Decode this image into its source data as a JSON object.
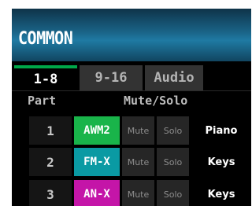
{
  "header": {
    "title": "COMMON"
  },
  "tabs": [
    {
      "label": "1-8",
      "active": true
    },
    {
      "label": "9-16",
      "active": false
    },
    {
      "label": "Audio",
      "active": false
    }
  ],
  "columns": {
    "part": "Part",
    "mute_solo": "Mute/Solo"
  },
  "rows": [
    {
      "part": "1",
      "engine": "AWM2",
      "engine_color": "#19b44a",
      "mute": "Mute",
      "solo": "Solo",
      "type": "Piano"
    },
    {
      "part": "2",
      "engine": "FM-X",
      "engine_color": "#0a9aa3",
      "mute": "Mute",
      "solo": "Solo",
      "type": "Keys"
    },
    {
      "part": "3",
      "engine": "AN-X",
      "engine_color": "#c415a8",
      "mute": "Mute",
      "solo": "Solo",
      "type": "Keys"
    }
  ],
  "colors": {
    "tab_active_accent": "#00a849",
    "header_blue": "#1f7aa3"
  }
}
